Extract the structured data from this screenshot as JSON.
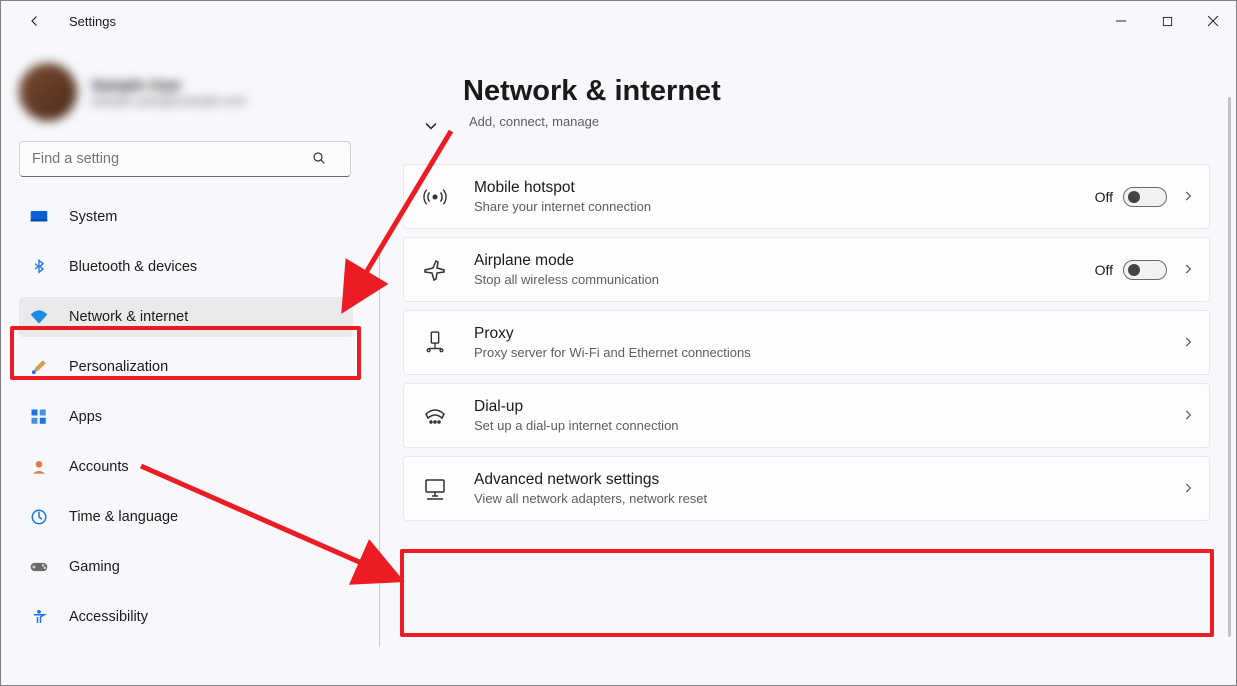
{
  "app_title": "Settings",
  "window": {
    "minimize": "Minimize",
    "maximize": "Maximize",
    "close": "Close"
  },
  "user": {
    "name": "Sample User",
    "email": "sample.user@example.com"
  },
  "search": {
    "placeholder": "Find a setting"
  },
  "sidebar": {
    "items": [
      {
        "label": "System"
      },
      {
        "label": "Bluetooth & devices"
      },
      {
        "label": "Network & internet"
      },
      {
        "label": "Personalization"
      },
      {
        "label": "Apps"
      },
      {
        "label": "Accounts"
      },
      {
        "label": "Time & language"
      },
      {
        "label": "Gaming"
      },
      {
        "label": "Accessibility"
      }
    ],
    "selected_index": 2
  },
  "page": {
    "title": "Network & internet",
    "vpn_sub": "Add, connect, manage"
  },
  "cards": {
    "hotspot": {
      "title": "Mobile hotspot",
      "sub": "Share your internet connection",
      "toggle": "Off"
    },
    "airplane": {
      "title": "Airplane mode",
      "sub": "Stop all wireless communication",
      "toggle": "Off"
    },
    "proxy": {
      "title": "Proxy",
      "sub": "Proxy server for Wi-Fi and Ethernet connections"
    },
    "dialup": {
      "title": "Dial-up",
      "sub": "Set up a dial-up internet connection"
    },
    "advanced": {
      "title": "Advanced network settings",
      "sub": "View all network adapters, network reset"
    }
  }
}
